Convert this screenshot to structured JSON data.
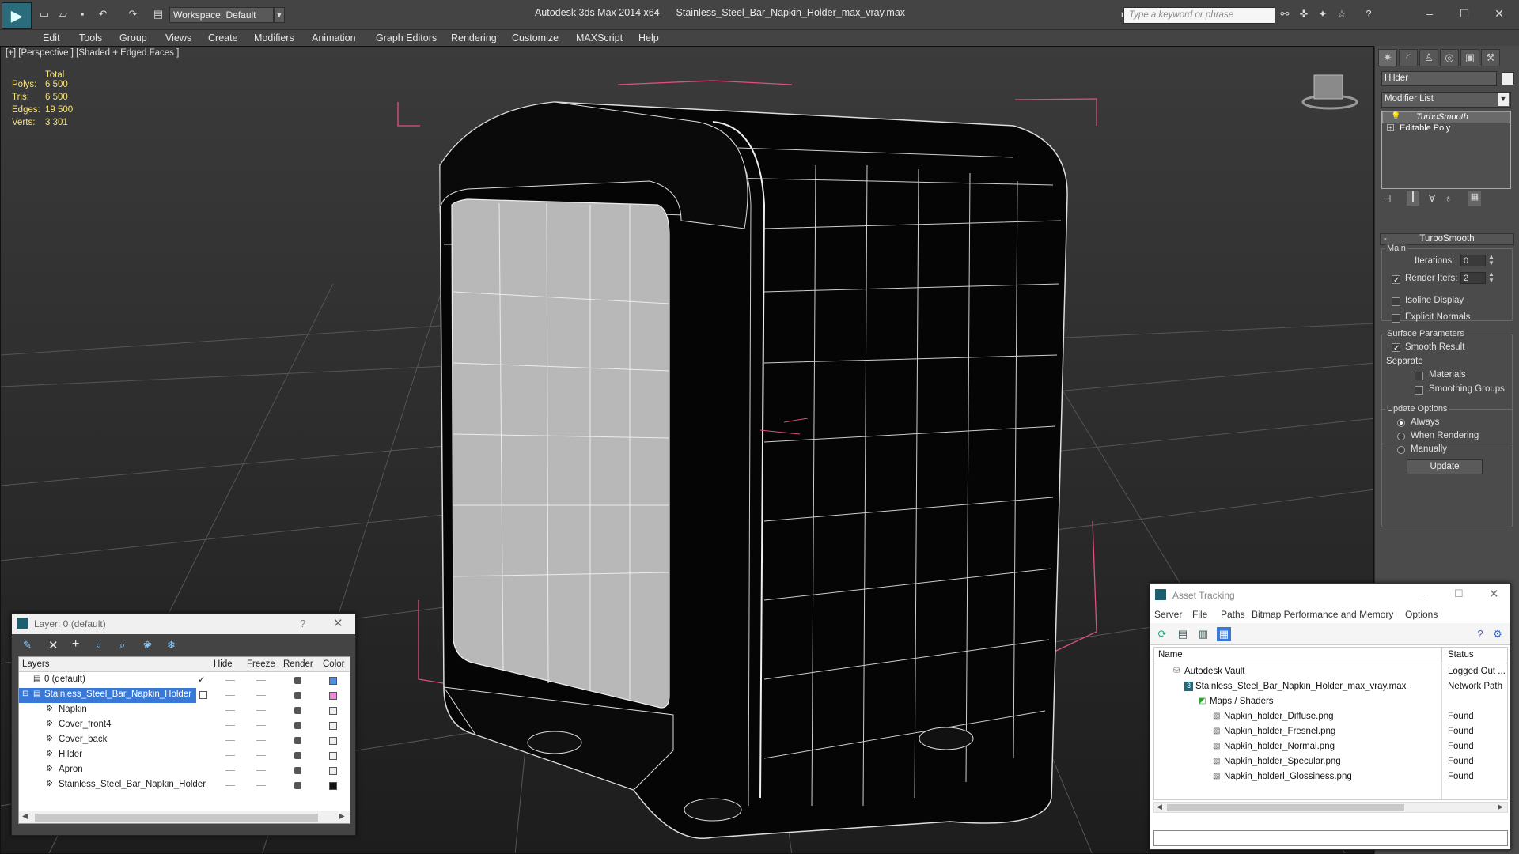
{
  "titlebar": {
    "workspace": "Workspace: Default",
    "app_title": "Autodesk 3ds Max  2014 x64",
    "file_title": "Stainless_Steel_Bar_Napkin_Holder_max_vray.max",
    "search_placeholder": "Type a keyword or phrase"
  },
  "menu": [
    "Edit",
    "Tools",
    "Group",
    "Views",
    "Create",
    "Modifiers",
    "Animation",
    "Graph Editors",
    "Rendering",
    "Customize",
    "MAXScript",
    "Help"
  ],
  "viewport": {
    "label": "[+] [Perspective ] [Shaded + Edged Faces ]",
    "stats": {
      "header": "Total",
      "rows": [
        {
          "label": "Polys:",
          "value": "6 500"
        },
        {
          "label": "Tris:",
          "value": "6 500"
        },
        {
          "label": "Edges:",
          "value": "19 500"
        },
        {
          "label": "Verts:",
          "value": "3 301"
        }
      ]
    }
  },
  "command_panel": {
    "object_name": "Hilder",
    "modifier_list": "Modifier List",
    "stack": [
      "TurboSmooth",
      "Editable Poly"
    ],
    "turbosmooth": {
      "title": "TurboSmooth",
      "main": "Main",
      "iterations_label": "Iterations:",
      "iterations": "0",
      "render_iters_label": "Render Iters:",
      "render_iters": "2",
      "render_iters_checked": true,
      "isoline": "Isoline Display",
      "explicit_normals": "Explicit Normals",
      "surface_params": "Surface Parameters",
      "smooth_result": "Smooth Result",
      "separate": "Separate",
      "materials": "Materials",
      "smoothing_groups": "Smoothing Groups",
      "update_options": "Update Options",
      "always": "Always",
      "when_rendering": "When Rendering",
      "manually": "Manually",
      "update_button": "Update"
    }
  },
  "layer_dialog": {
    "title": "Layer: 0 (default)",
    "help": "?",
    "columns": [
      "Layers",
      "Hide",
      "Freeze",
      "Render",
      "Color"
    ],
    "rows": [
      {
        "name": "0 (default)",
        "color": "#4f8fe0",
        "level": 0,
        "check": true
      },
      {
        "name": "Stainless_Steel_Bar_Napkin_Holder",
        "color": "#e88ad8",
        "level": 0,
        "selected": true
      },
      {
        "name": "Napkin",
        "color": "#f0f0f0",
        "level": 1
      },
      {
        "name": "Cover_front4",
        "color": "#f0f0f0",
        "level": 1
      },
      {
        "name": "Cover_back",
        "color": "#f0f0f0",
        "level": 1
      },
      {
        "name": "Hilder",
        "color": "#f0f0f0",
        "level": 1
      },
      {
        "name": "Apron",
        "color": "#f0f0f0",
        "level": 1
      },
      {
        "name": "Stainless_Steel_Bar_Napkin_Holder",
        "color": "#111111",
        "level": 1
      }
    ]
  },
  "asset_dialog": {
    "title": "Asset Tracking",
    "menu": [
      "Server",
      "File",
      "Paths",
      "Bitmap Performance and Memory",
      "Options"
    ],
    "columns": [
      "Name",
      "Status"
    ],
    "rows": [
      {
        "name": "Autodesk Vault",
        "status": "Logged Out ...",
        "indent": 1
      },
      {
        "name": "Stainless_Steel_Bar_Napkin_Holder_max_vray.max",
        "status": "Network Path",
        "indent": 2
      },
      {
        "name": "Maps / Shaders",
        "status": "",
        "indent": 3
      },
      {
        "name": "Napkin_holder_Diffuse.png",
        "status": "Found",
        "indent": 4
      },
      {
        "name": "Napkin_holder_Fresnel.png",
        "status": "Found",
        "indent": 4
      },
      {
        "name": "Napkin_holder_Normal.png",
        "status": "Found",
        "indent": 4
      },
      {
        "name": "Napkin_holder_Specular.png",
        "status": "Found",
        "indent": 4
      },
      {
        "name": "Napkin_holderl_Glossiness.png",
        "status": "Found",
        "indent": 4
      }
    ]
  },
  "colors": {
    "accent_selection": "#3a78d8",
    "stats_text": "#f4e27a",
    "bbox_corners": "#e0507a"
  }
}
